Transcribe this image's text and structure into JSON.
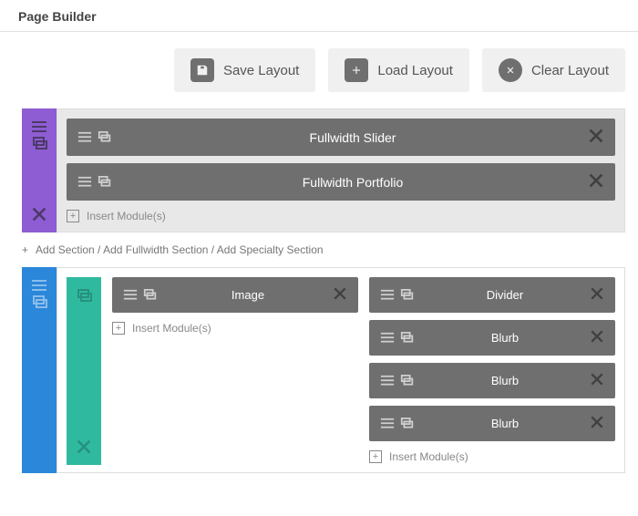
{
  "title": "Page Builder",
  "toolbar": {
    "save": "Save Layout",
    "load": "Load Layout",
    "clear": "Clear Layout"
  },
  "sections": [
    {
      "color": "purple",
      "modules": [
        {
          "title": "Fullwidth Slider"
        },
        {
          "title": "Fullwidth Portfolio"
        }
      ],
      "insert": "Insert Module(s)"
    },
    {
      "color": "blue",
      "rows": [
        {
          "columns": [
            {
              "modules": [
                {
                  "title": "Image"
                }
              ],
              "insert": "Insert Module(s)"
            },
            {
              "modules": [
                {
                  "title": "Divider"
                },
                {
                  "title": "Blurb"
                },
                {
                  "title": "Blurb"
                },
                {
                  "title": "Blurb"
                }
              ],
              "insert": "Insert Module(s)"
            }
          ]
        }
      ]
    }
  ],
  "add_line": "Add Section / Add Fullwidth Section / Add Specialty Section"
}
